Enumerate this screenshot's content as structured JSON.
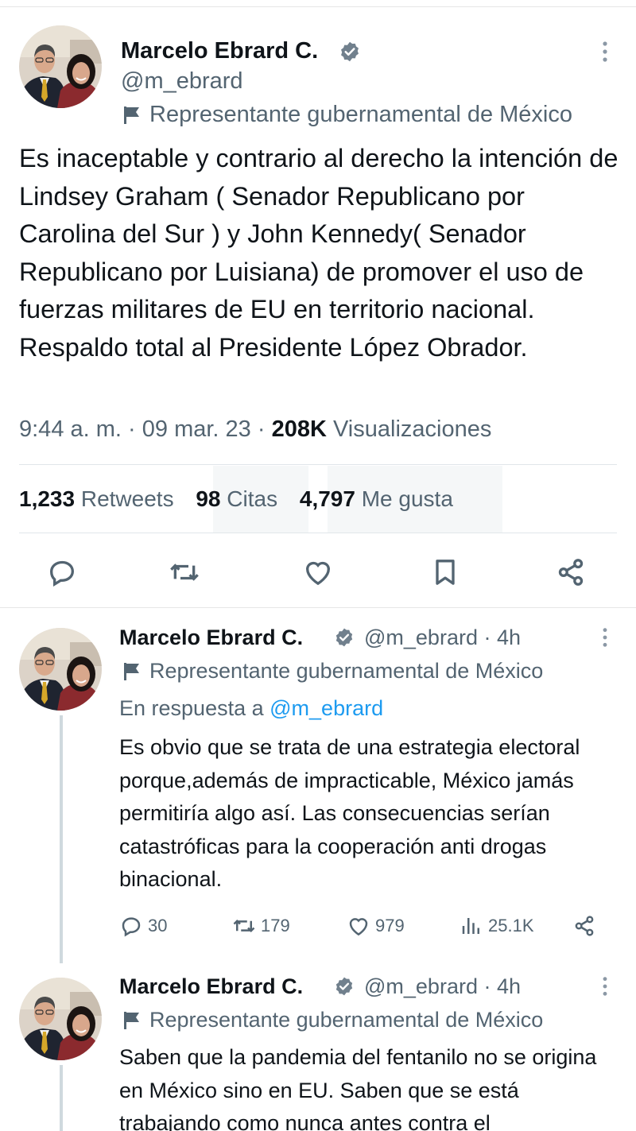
{
  "main_tweet": {
    "author_name": "Marcelo Ebrard C.",
    "handle": "@m_ebrard",
    "affiliation": "Representante gubernamental de México",
    "text": "Es inaceptable y contrario al derecho la intención de Lindsey Graham ( Senador Republicano por Carolina del Sur ) y John Kennedy( Senador Republicano por Luisiana) de promover el uso de fuerzas militares de EU en territorio nacional. Respaldo total al Presidente López Obrador.",
    "time": "9:44 a. m.",
    "date": "09 mar. 23",
    "separator": "·",
    "views_count": "208K",
    "views_label": "Visualizaciones",
    "stats": {
      "retweets_count": "1,233",
      "retweets_label": "Retweets",
      "quotes_count": "98",
      "quotes_label": "Citas",
      "likes_count": "4,797",
      "likes_label": "Me gusta"
    },
    "actions": [
      "reply-icon",
      "retweet-icon",
      "like-icon",
      "bookmark-icon",
      "share-icon"
    ]
  },
  "replies": [
    {
      "author_name": "Marcelo Ebrard C.",
      "handle_time": "@m_ebrard · 4h",
      "affiliation": "Representante gubernamental de México",
      "reply_to_label": "En respuesta a",
      "reply_to_mention": "@m_ebrard",
      "text": "Es obvio que se trata de una estrategia electoral porque,además de impracticable, México jamás permitiría algo así. Las consecuencias serían catastróficas para la cooperación anti drogas binacional.",
      "counts": {
        "replies": "30",
        "retweets": "179",
        "likes": "979",
        "views": "25.1K"
      }
    },
    {
      "author_name": "Marcelo Ebrard C.",
      "handle_time": "@m_ebrard · 4h",
      "affiliation": "Representante gubernamental de México",
      "text": "Saben que la pandemia del fentanilo no se origina en México sino en EU. Saben que se está trabajando como nunca antes contra el"
    }
  ],
  "colors": {
    "text": "#0f1419",
    "secondary": "#536471",
    "link": "#1d9bf0",
    "divider": "#e1e6ea",
    "verified_badge": "#71808d"
  }
}
